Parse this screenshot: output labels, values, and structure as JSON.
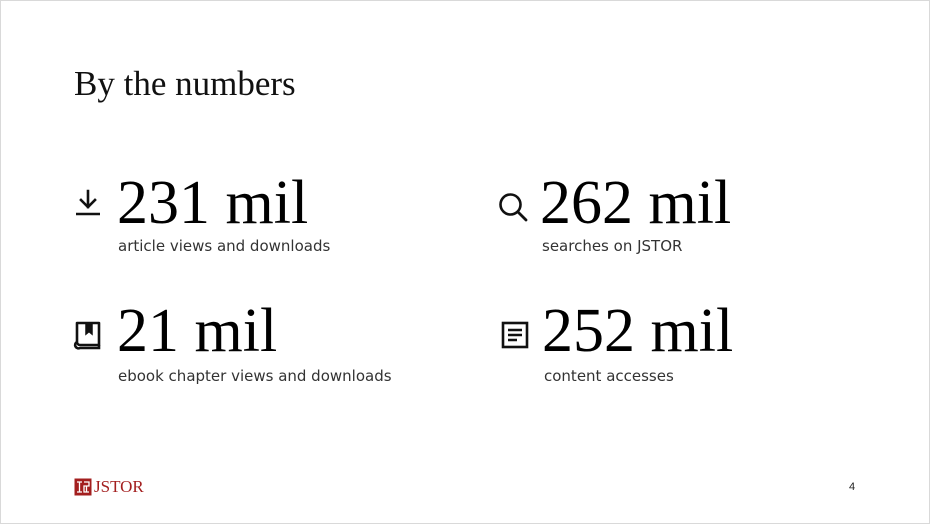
{
  "slide": {
    "title": "By the numbers",
    "page_number": "4"
  },
  "stats": [
    {
      "icon": "download-icon",
      "value": "231 mil",
      "caption": "article views and downloads"
    },
    {
      "icon": "search-icon",
      "value": "262 mil",
      "caption": "searches on JSTOR"
    },
    {
      "icon": "book-icon",
      "value": "21 mil",
      "caption": "ebook chapter views and downloads"
    },
    {
      "icon": "document-icon",
      "value": "252 mil",
      "caption": "content accesses"
    }
  ],
  "logo": {
    "text": "JSTOR",
    "color": "#a31f1f"
  }
}
